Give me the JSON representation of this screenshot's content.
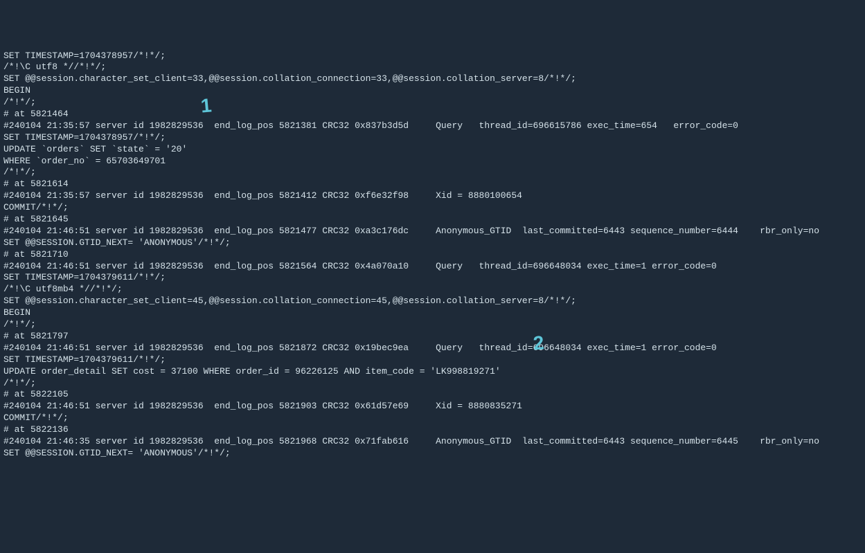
{
  "lines": [
    "SET TIMESTAMP=1704378957/*!*/;",
    "/*!\\C utf8 *//*!*/;",
    "SET @@session.character_set_client=33,@@session.collation_connection=33,@@session.collation_server=8/*!*/;",
    "BEGIN",
    "/*!*/;",
    "# at 5821464",
    "#240104 21:35:57 server id 1982829536  end_log_pos 5821381 CRC32 0x837b3d5d     Query   thread_id=696615786 exec_time=654   error_code=0",
    "SET TIMESTAMP=1704378957/*!*/;",
    "UPDATE `orders` SET `state` = '20'",
    "WHERE `order_no` = 65703649701",
    "/*!*/;",
    "# at 5821614",
    "#240104 21:35:57 server id 1982829536  end_log_pos 5821412 CRC32 0xf6e32f98     Xid = 8880100654",
    "COMMIT/*!*/;",
    "# at 5821645",
    "#240104 21:46:51 server id 1982829536  end_log_pos 5821477 CRC32 0xa3c176dc     Anonymous_GTID  last_committed=6443 sequence_number=6444    rbr_only=no",
    "SET @@SESSION.GTID_NEXT= 'ANONYMOUS'/*!*/;",
    "# at 5821710",
    "#240104 21:46:51 server id 1982829536  end_log_pos 5821564 CRC32 0x4a070a10     Query   thread_id=696648034 exec_time=1 error_code=0",
    "SET TIMESTAMP=1704379611/*!*/;",
    "/*!\\C utf8mb4 *//*!*/;",
    "SET @@session.character_set_client=45,@@session.collation_connection=45,@@session.collation_server=8/*!*/;",
    "BEGIN",
    "/*!*/;",
    "# at 5821797",
    "#240104 21:46:51 server id 1982829536  end_log_pos 5821872 CRC32 0x19bec9ea     Query   thread_id=696648034 exec_time=1 error_code=0",
    "SET TIMESTAMP=1704379611/*!*/;",
    "UPDATE order_detail SET cost = 37100 WHERE order_id = 96226125 AND item_code = 'LK998819271'",
    "/*!*/;",
    "# at 5822105",
    "#240104 21:46:51 server id 1982829536  end_log_pos 5821903 CRC32 0x61d57e69     Xid = 8880835271",
    "COMMIT/*!*/;",
    "# at 5822136",
    "#240104 21:46:35 server id 1982829536  end_log_pos 5821968 CRC32 0x71fab616     Anonymous_GTID  last_committed=6443 sequence_number=6445    rbr_only=no",
    "SET @@SESSION.GTID_NEXT= 'ANONYMOUS'/*!*/;"
  ],
  "annotations": {
    "one": "1",
    "two": "2"
  }
}
